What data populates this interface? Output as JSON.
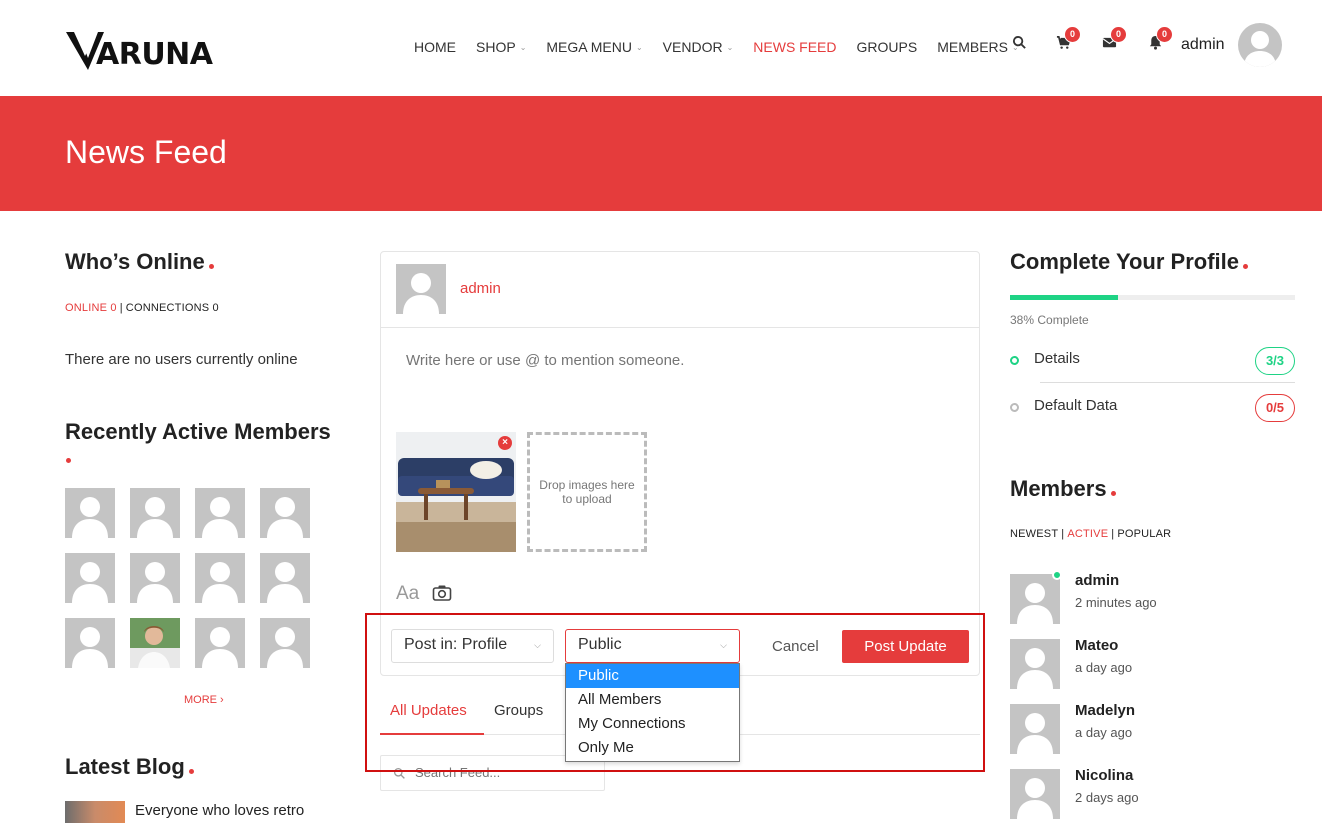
{
  "header": {
    "logo_text": "ARUNA",
    "nav": [
      {
        "label": "HOME",
        "dropdown": false,
        "active": false
      },
      {
        "label": "SHOP",
        "dropdown": true,
        "active": false
      },
      {
        "label": "MEGA MENU",
        "dropdown": true,
        "active": false
      },
      {
        "label": "VENDOR",
        "dropdown": true,
        "active": false
      },
      {
        "label": "NEWS FEED",
        "dropdown": false,
        "active": true
      },
      {
        "label": "GROUPS",
        "dropdown": false,
        "active": false
      },
      {
        "label": "MEMBERS",
        "dropdown": true,
        "active": false
      }
    ],
    "icons": [
      {
        "name": "search-icon",
        "badge": null
      },
      {
        "name": "cart-icon",
        "badge": "0"
      },
      {
        "name": "mail-icon",
        "badge": "0"
      },
      {
        "name": "bell-icon",
        "badge": "0"
      }
    ],
    "user_name": "admin"
  },
  "banner": {
    "title": "News Feed"
  },
  "left": {
    "whos_online": {
      "title": "Who’s Online",
      "online_label": "ONLINE 0",
      "connections_label": "CONNECTIONS 0",
      "empty_text": "There are no users currently online"
    },
    "recent_members": {
      "title": "Recently Active Members",
      "count": 12,
      "photo_index": 9,
      "more": "MORE ›"
    },
    "latest_blog": {
      "title": "Latest Blog",
      "first_post": "Everyone who loves retro"
    }
  },
  "post": {
    "author": "admin",
    "placeholder": "Write here or use @ to mention someone.",
    "remove_icon": "×",
    "dropzone_text": "Drop images here to upload",
    "text_tool": "Aa",
    "post_in_label": "Post in: Profile",
    "visibility_value": "Public",
    "visibility_options": [
      "Public",
      "All Members",
      "My Connections",
      "Only Me"
    ],
    "cancel_label": "Cancel",
    "submit_label": "Post Update"
  },
  "feed": {
    "tabs": [
      "All Updates",
      "Groups"
    ],
    "search_placeholder": "Search Feed..."
  },
  "right": {
    "complete_profile": {
      "title": "Complete Your Profile",
      "progress_percent": 38,
      "progress_text": "38% Complete",
      "items": [
        {
          "label": "Details",
          "count": "3/3",
          "done": true
        },
        {
          "label": "Default Data",
          "count": "0/5",
          "done": false
        }
      ]
    },
    "members": {
      "title": "Members",
      "filter_newest": "NEWEST",
      "filter_active": "ACTIVE",
      "filter_popular": "POPULAR",
      "list": [
        {
          "name": "admin",
          "time": "2 minutes ago",
          "online": true
        },
        {
          "name": "Mateo",
          "time": "a day ago",
          "online": false
        },
        {
          "name": "Madelyn",
          "time": "a day ago",
          "online": false
        },
        {
          "name": "Nicolina",
          "time": "2 days ago",
          "online": false
        }
      ]
    }
  },
  "colors": {
    "accent": "#e53c3c",
    "success": "#1ed385",
    "select_blue": "#1e90ff"
  }
}
